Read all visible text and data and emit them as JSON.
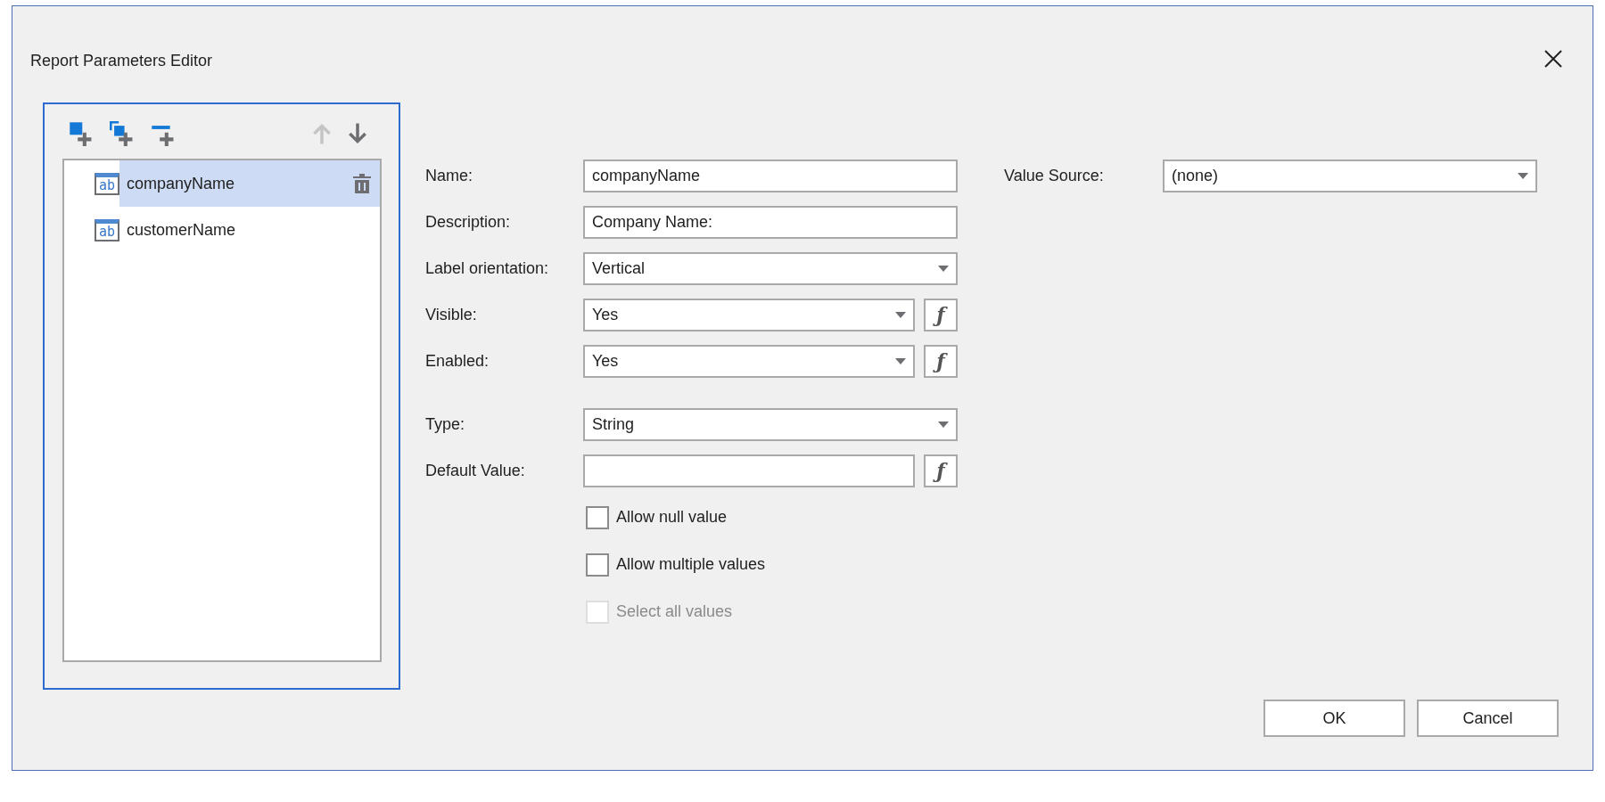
{
  "window": {
    "title": "Report Parameters Editor"
  },
  "toolbar": [
    {
      "kind": "add",
      "disabled": false
    },
    {
      "kind": "duplicate",
      "disabled": false
    },
    {
      "kind": "add-separator",
      "disabled": false
    },
    {
      "kind": "move-up",
      "disabled": true
    },
    {
      "kind": "move-down",
      "disabled": false
    }
  ],
  "parameters": [
    {
      "type_icon": "ab",
      "name": "companyName",
      "selected": true
    },
    {
      "type_icon": "ab",
      "name": "customerName",
      "selected": false
    }
  ],
  "field_groups": [
    [
      {
        "label": "Name:",
        "kind": "text",
        "value": "companyName"
      },
      {
        "label": "Description:",
        "kind": "text",
        "value": "Company Name:"
      },
      {
        "label": "Label orientation:",
        "kind": "combo",
        "value": "Vertical"
      },
      {
        "label": "Visible:",
        "kind": "combo-expr",
        "value": "Yes",
        "expr_button": "ƒ"
      },
      {
        "label": "Enabled:",
        "kind": "combo-expr",
        "value": "Yes",
        "expr_button": "ƒ"
      }
    ],
    [
      {
        "label": "Type:",
        "kind": "combo",
        "value": "String"
      },
      {
        "label": "Default Value:",
        "kind": "text-expr",
        "expr_button": "ƒ"
      }
    ]
  ],
  "checkboxes": [
    {
      "label": "Allow null value",
      "checked": false,
      "disabled": false
    },
    {
      "label": "Allow multiple values",
      "checked": false,
      "disabled": false
    },
    {
      "label": "Select all values",
      "checked": false,
      "disabled": true
    }
  ],
  "value_source": {
    "label": "Value Source:",
    "value": "(none)"
  },
  "buttons": [
    "OK",
    "Cancel"
  ]
}
